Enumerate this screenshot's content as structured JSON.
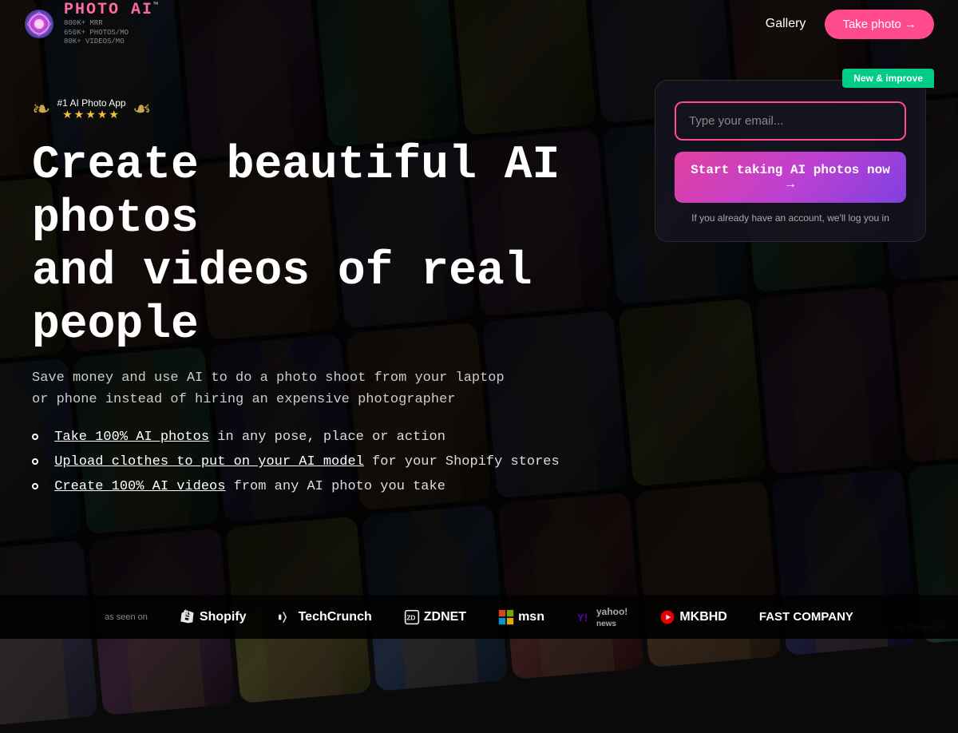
{
  "nav": {
    "logo_photo": "PHOTO",
    "logo_ai": "AI",
    "logo_tm": "™",
    "stat1": "800K+ MRR",
    "stat2": "650K+ PHOTOS/MO",
    "stat3": "80K+ VIDEOS/MO",
    "gallery_label": "Gallery",
    "take_photo_label": "Take photo →"
  },
  "award": {
    "title": "#1 AI Photo App",
    "stars": "★★★★★"
  },
  "hero": {
    "headline": "Create beautiful AI photos\nand videos of real people",
    "subheadline": "Save money and use AI to do a photo shoot from your laptop or phone instead of hiring an expensive photographer",
    "feature1_link": "Take 100% AI photos",
    "feature1_rest": " in any pose, place or action",
    "feature2_link": "Upload clothes to put on your AI model",
    "feature2_rest": " for your Shopify stores",
    "feature3_link": "Create 100% AI videos",
    "feature3_rest": " from any AI photo you take"
  },
  "signup": {
    "new_badge": "New & improve",
    "email_placeholder": "Type your email...",
    "cta_label": "Start taking AI photos now →",
    "login_hint": "If you already have an account, we'll log you in"
  },
  "bottom_bar": {
    "as_seen": "as seen on",
    "brands": [
      "Shopify",
      "TechCrunch",
      "ZDNET",
      "msn",
      "yahoo! news",
      "MKBHD",
      "FAST COMPANY"
    ]
  },
  "levelsio": "by @levelsio",
  "colors": {
    "accent_pink": "#ff4b8b",
    "accent_green": "#00cc88",
    "gradient_start": "#e040a0",
    "gradient_end": "#8040e0"
  }
}
